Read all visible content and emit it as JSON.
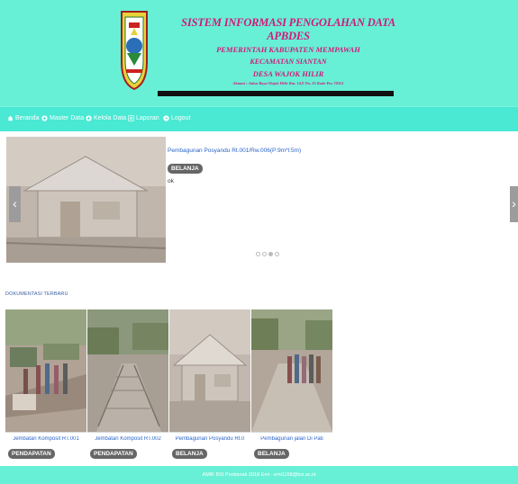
{
  "header": {
    "title_main": "SISTEM INFORMASI PENGOLAHAN DATA APBDES",
    "title_kabupaten": "PEMERINTAH KABUPATEN MEMPAWAH",
    "title_kecamatan": "KECAMATAN SIANTAN",
    "title_desa": "DESA WAJOK HILIR",
    "address": "Alamat : Jalan Raya Wajok Hilir Km. 14,9 No. 25 Kode Pos 78351",
    "title_color": "#d11a7a",
    "bg_color": "#67f0d6"
  },
  "nav": {
    "items": [
      {
        "label": "Beranda",
        "icon": "home-icon"
      },
      {
        "label": "Master Data",
        "icon": "plus-circle-icon"
      },
      {
        "label": "Kelola Data",
        "icon": "plus-circle-icon"
      },
      {
        "label": "Laporan",
        "icon": "list-icon"
      },
      {
        "label": "Logout",
        "icon": "logout-icon"
      }
    ]
  },
  "carousel": {
    "caption": "Pembagunan Posyandu Rt.001/Rw.006(P:9m*l:5m)",
    "badge": "BELANJA",
    "text": "ok",
    "prev_label": "‹",
    "next_label": "›",
    "dot_count": 4,
    "active_dot": 2
  },
  "section": {
    "title": "DOKUMENTASI TERBARU"
  },
  "cards": [
    {
      "title": "Jembatan Komposit RT.001",
      "badge": "PENDAPATAN"
    },
    {
      "title": "Jembatan Komposit RT.002",
      "badge": "PENDAPATAN"
    },
    {
      "title": "Pembagunan Posyandu Rt.0",
      "badge": "BELANJA"
    },
    {
      "title": "Pembagunan jalan Di Pati",
      "badge": "BELANJA"
    }
  ],
  "footer": {
    "text": "AMIK BSI Pontianak 2018 Emi - emi1158@bsi.ac.id"
  }
}
